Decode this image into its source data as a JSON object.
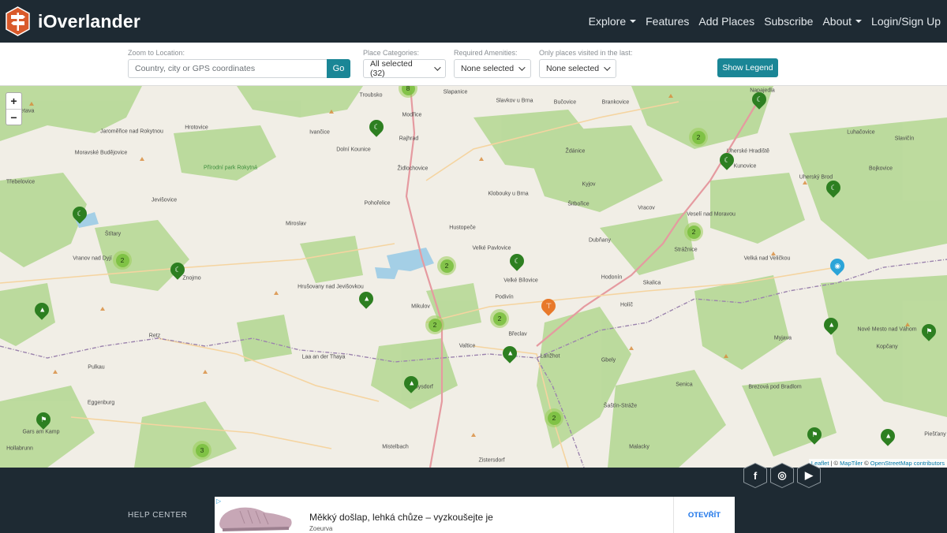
{
  "app": {
    "name": "iOverlander",
    "logo_icon": "signpost-icon",
    "brand_color": "#d95a2b"
  },
  "nav": {
    "items": [
      {
        "label": "Explore",
        "has_caret": true
      },
      {
        "label": "Features",
        "has_caret": false
      },
      {
        "label": "Add Places",
        "has_caret": false
      },
      {
        "label": "Subscribe",
        "has_caret": false
      },
      {
        "label": "About",
        "has_caret": true
      },
      {
        "label": "Login/Sign Up",
        "has_caret": false
      }
    ]
  },
  "filters": {
    "location_label": "Zoom to Location:",
    "location_placeholder": "Country, city or GPS coordinates",
    "location_value": "",
    "go_label": "Go",
    "categories_label": "Place Categories:",
    "categories_value": "All selected (32)",
    "amenities_label": "Required Amenities:",
    "amenities_value": "None selected",
    "visited_label": "Only places visited in the last:",
    "visited_value": "None selected",
    "legend_button": "Show Legend",
    "accent_color": "#1a8696"
  },
  "map": {
    "zoom_in": "+",
    "zoom_out": "−",
    "attribution": {
      "leaflet": "Leaflet",
      "sep1": " | © ",
      "maptiler": "MapTiler",
      "sep2": " © ",
      "osm": "OpenStreetMap contributors"
    },
    "cluster_counts": [
      "8",
      "2",
      "2",
      "2",
      "2",
      "2",
      "2",
      "2",
      "3"
    ],
    "place_labels": [
      "Želetava",
      "Troubsko",
      "Slapanice",
      "Slavkov u Brna",
      "Bučovice",
      "Brankovice",
      "Napajedla",
      "Jaroměřice nad Rokytnou",
      "Hrotovice",
      "Moravské Budějovice",
      "Ivančice",
      "Modřice",
      "Rajhrad",
      "Ždánice",
      "Uherské Hradiště",
      "Kunovice",
      "Luhačovice",
      "Slavičín",
      "Přírodní park Rokytná",
      "Dolní Kounice",
      "Židlochovice",
      "Bojkovice",
      "Třebelovice",
      "Jevišovice",
      "Pohořelice",
      "Klobouky u Brna",
      "Kyjov",
      "Uherský Brod",
      "Šitbořice",
      "Vracov",
      "Veselí nad Moravou",
      "Hustopeče",
      "Dubňany",
      "Štítary",
      "Miroslav",
      "Vranov nad Dyjí",
      "Hrušovany nad Jevišovkou",
      "Velké Pavlovice",
      "Strážnice",
      "Velká nad Veličkou",
      "Znojmo",
      "Velké Bílovice",
      "Hodonín",
      "Skalica",
      "Mikulov",
      "Podivín",
      "Břeclav",
      "Holíč",
      "Retz",
      "Valtice",
      "Lanžhot",
      "Myjava",
      "Nové Mesto nad Váhom",
      "Laa an der Thaya",
      "Pulkau",
      "Gbely",
      "Kopčany",
      "Brezová pod Bradlom",
      "Eggenburg",
      "Poysdorf",
      "Šaštín-Stráže",
      "Senica",
      "Mistelbach",
      "Zistersdorf",
      "Malacky",
      "Hollabrunn",
      "Gars am Kamp",
      "Piešťany"
    ]
  },
  "footer": {
    "social": [
      {
        "icon": "facebook-icon",
        "glyph": "f"
      },
      {
        "icon": "instagram-icon",
        "glyph": "◎"
      },
      {
        "icon": "youtube-icon",
        "glyph": "▶"
      }
    ],
    "help_center": "HELP CENTER",
    "ad": {
      "headline": "Měkký došlap, lehká chůze – vyzkoušejte je",
      "brand": "Zoeurva",
      "cta": "OTEVŘÍT"
    }
  }
}
